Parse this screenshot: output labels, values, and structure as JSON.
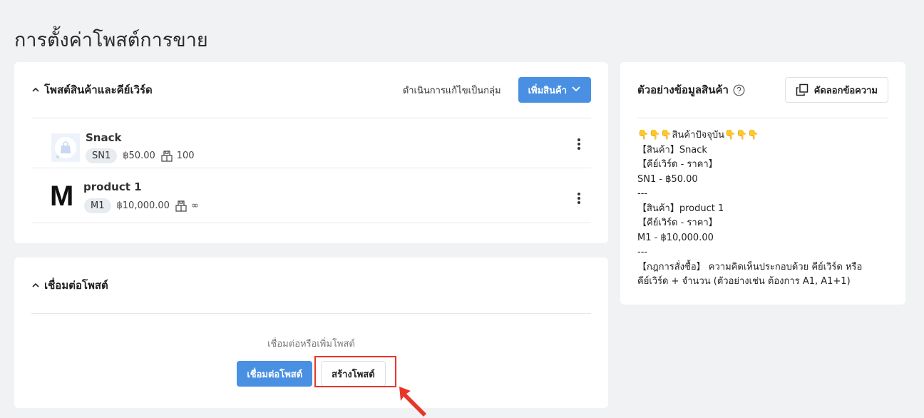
{
  "page_title": "การตั้งค่าโพสต์การขาย",
  "products_section": {
    "title": "โพสต์สินค้าและคีย์เวิร์ด",
    "batch_edit_label": "ดำเนินการแก้ไขเป็นกลุ่ม",
    "add_product_label": "เพิ่มสินค้า",
    "items": [
      {
        "name": "Snack",
        "keyword": "SN1",
        "price": "฿50.00",
        "stock": "100",
        "thumb": "bag-icon"
      },
      {
        "name": "product 1",
        "keyword": "M1",
        "price": "฿10,000.00",
        "stock": "∞",
        "thumb_letter": "M"
      }
    ]
  },
  "connect_section": {
    "title": "เชื่อมต่อโพสต์",
    "hint": "เชื่อมต่อหรือเพิ่มโพสต์",
    "connect_button": "เชื่อมต่อโพสต์",
    "create_button": "สร้างโพสต์"
  },
  "preview_section": {
    "title": "ตัวอย่างข้อมูลสินค้า",
    "copy_label": "คัดลอกข้อความ",
    "body": "👇👇👇สินค้าปัจจุบัน👇👇👇\n【สินค้า】Snack\n【คีย์เวิร์ด - ราคา】\nSN1 - ฿50.00\n---\n【สินค้า】product 1\n【คีย์เวิร์ด - ราคา】\nM1 - ฿10,000.00\n---\n【กฎการสั่งซื้อ】 ความคิดเห็นประกอบด้วย คีย์เวิร์ด หรือ คีย์เวิร์ด + จำนวน (ตัวอย่างเช่น ต้องการ A1, A1+1)"
  },
  "colors": {
    "primary": "#4a90e2",
    "highlight": "#e8352a",
    "background": "#f1f2f4"
  }
}
